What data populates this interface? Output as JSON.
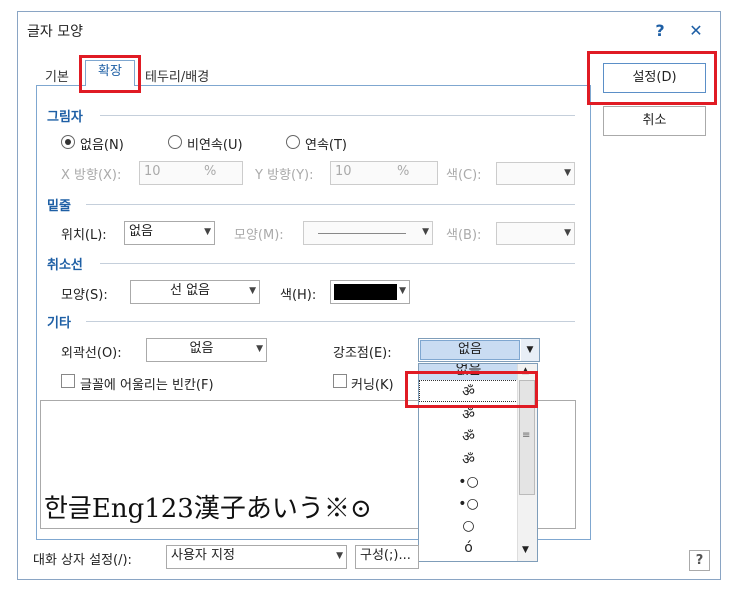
{
  "window": {
    "title": "글자 모양",
    "help_label": "?",
    "close_label": "✕"
  },
  "tabs": [
    {
      "label": "기본"
    },
    {
      "label": "확장",
      "active": true
    },
    {
      "label": "테두리/배경"
    }
  ],
  "buttons": {
    "ok": "설정(D)",
    "cancel": "취소"
  },
  "shadow": {
    "section": "그림자",
    "options": [
      "없음(N)",
      "비연속(U)",
      "연속(T)"
    ],
    "selected": "없음(N)",
    "x_label": "X 방향(X):",
    "x_value": "10",
    "x_unit": "%",
    "y_label": "Y 방향(Y):",
    "y_value": "10",
    "y_unit": "%",
    "color_label": "색(C):"
  },
  "underline": {
    "section": "밑줄",
    "pos_label": "위치(L):",
    "pos_value": "없음",
    "shape_label": "모양(M):",
    "color_label": "색(B):"
  },
  "strike": {
    "section": "취소선",
    "shape_label": "모양(S):",
    "shape_value": "선 없음",
    "color_label": "색(H):",
    "color_value": "#000000"
  },
  "etc": {
    "section": "기타",
    "outline_label": "외곽선(O):",
    "outline_value": "없음",
    "emphasis_label": "강조점(E):",
    "emphasis_value": "없음",
    "font_space_label": "글꼴에 어울리는 빈칸(F)",
    "kerning_label": "커닝(K)"
  },
  "emphasis_list": {
    "items": [
      "없음",
      "ॐ",
      "ॐ",
      "ॐ",
      "ॐ",
      "•○",
      "•○",
      "○",
      "ó"
    ]
  },
  "preview": {
    "text": "한글Eng123漢子あいう※⊙"
  },
  "footer": {
    "setting_label": "대화 상자 설정(/):",
    "setting_value": "사용자 지정",
    "config_label": "구성(;)...",
    "help": "?"
  }
}
